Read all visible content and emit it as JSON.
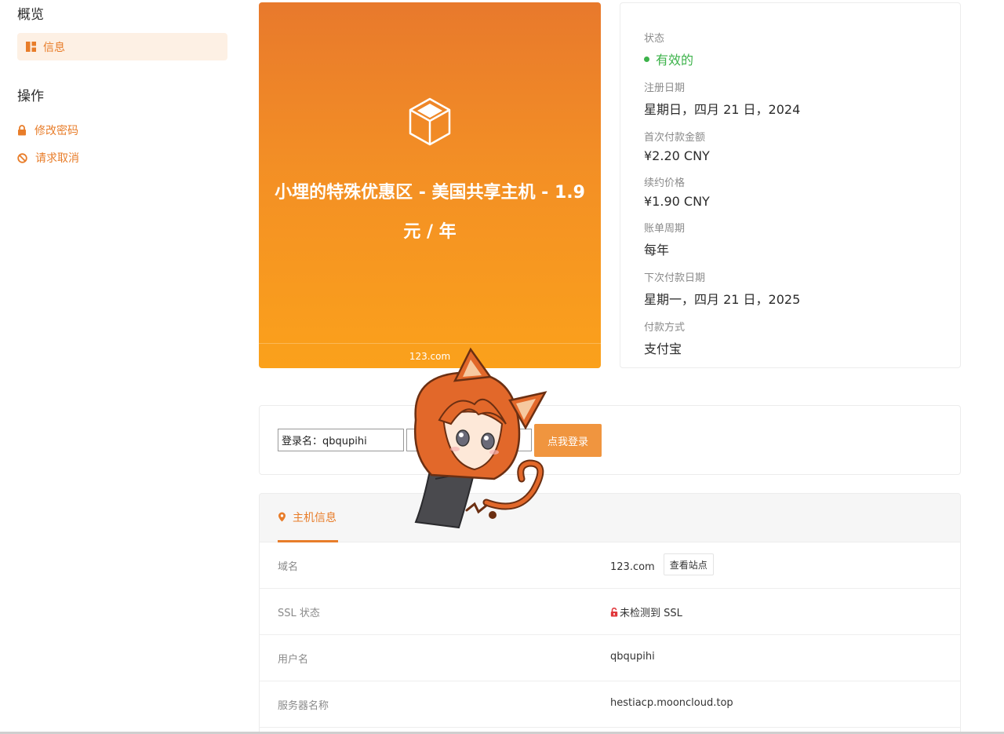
{
  "sidebar": {
    "overview_title": "概览",
    "info_item": "信息",
    "actions_title": "操作",
    "change_password": "修改密码",
    "request_cancel": "请求取消"
  },
  "product": {
    "title": "小埋的特殊优惠区 - 美国共享主机 - 1.9 元 / 年",
    "domain": "123.com"
  },
  "details": {
    "status_label": "状态",
    "status_value": "有效的",
    "reg_date_label": "注册日期",
    "reg_date_value": "星期日，四月 21 日，2024",
    "first_payment_label": "首次付款金额",
    "first_payment_value": "¥2.20 CNY",
    "renew_price_label": "续约价格",
    "renew_price_value": "¥1.90 CNY",
    "billing_cycle_label": "账单周期",
    "billing_cycle_value": "每年",
    "next_due_label": "下次付款日期",
    "next_due_value": "星期一，四月 21 日，2025",
    "payment_method_label": "付款方式",
    "payment_method_value": "支付宝"
  },
  "login": {
    "username_value": "登录名：qbqupihi",
    "password_value": "",
    "login_button": "点我登录"
  },
  "host_info": {
    "tab_label": "主机信息",
    "rows": [
      {
        "label": "域名",
        "value": "123.com",
        "button": "查看站点"
      },
      {
        "label": "SSL 状态",
        "value": "未检测到 SSL"
      },
      {
        "label": "用户名",
        "value": "qbqupihi"
      },
      {
        "label": "服务器名称",
        "value": "hestiacp.mooncloud.top"
      }
    ]
  },
  "colors": {
    "accent": "#e87d2a",
    "status_green": "#3cb24a",
    "ssl_red": "#e0363a"
  },
  "icons": {
    "info": "dashboard-icon",
    "password": "lock-icon",
    "cancel": "ban-icon",
    "product": "cube-icon",
    "host_tab": "map-pin-icon",
    "ssl": "unlocked-icon"
  }
}
